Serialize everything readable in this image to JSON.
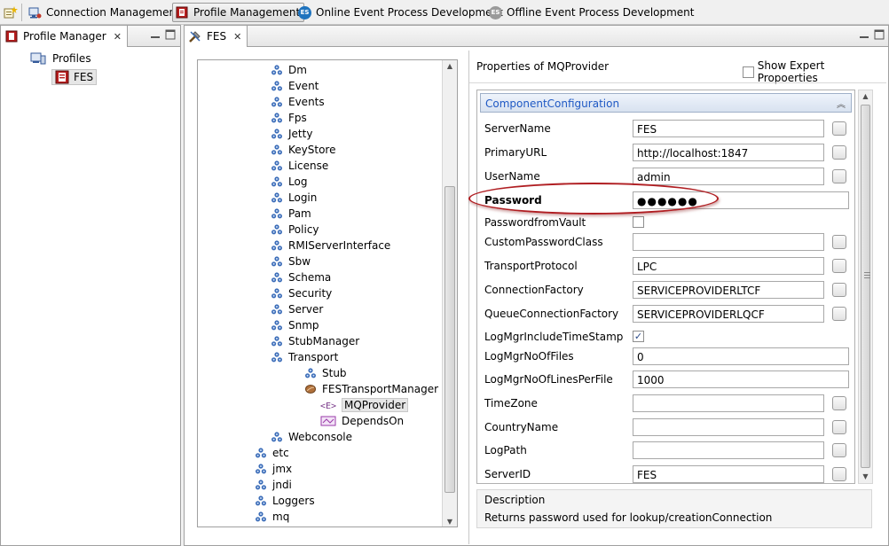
{
  "perspectives": [
    {
      "label": "Connection Management",
      "icon": "connection-icon"
    },
    {
      "label": "Profile Management",
      "icon": "profile-icon",
      "active": true
    },
    {
      "label": "Online Event Process Development",
      "icon": "es-online-icon"
    },
    {
      "label": "Offline Event Process Development",
      "icon": "es-offline-icon"
    }
  ],
  "profile_manager": {
    "tab_label": "Profile Manager",
    "root_label": "Profiles",
    "child_label": "FES"
  },
  "editor": {
    "tab_label": "FES",
    "tree": [
      {
        "label": "Dm",
        "icon": "package-icon"
      },
      {
        "label": "Event",
        "icon": "package-icon"
      },
      {
        "label": "Events",
        "icon": "package-icon"
      },
      {
        "label": "Fps",
        "icon": "package-icon"
      },
      {
        "label": "Jetty",
        "icon": "package-icon"
      },
      {
        "label": "KeyStore",
        "icon": "package-icon"
      },
      {
        "label": "License",
        "icon": "package-icon"
      },
      {
        "label": "Log",
        "icon": "package-icon"
      },
      {
        "label": "Login",
        "icon": "package-icon"
      },
      {
        "label": "Pam",
        "icon": "package-icon"
      },
      {
        "label": "Policy",
        "icon": "package-icon"
      },
      {
        "label": "RMIServerInterface",
        "icon": "package-icon"
      },
      {
        "label": "Sbw",
        "icon": "package-icon"
      },
      {
        "label": "Schema",
        "icon": "package-icon"
      },
      {
        "label": "Security",
        "icon": "package-icon"
      },
      {
        "label": "Server",
        "icon": "package-icon"
      },
      {
        "label": "Snmp",
        "icon": "package-icon"
      },
      {
        "label": "StubManager",
        "icon": "package-icon"
      },
      {
        "label": "Transport",
        "icon": "package-icon"
      },
      {
        "label": "Stub",
        "icon": "package-icon"
      },
      {
        "label": "FESTransportManager",
        "icon": "bean-icon"
      },
      {
        "label": "MQProvider",
        "icon": "element-icon",
        "selected": true
      },
      {
        "label": "DependsOn",
        "icon": "depends-icon"
      },
      {
        "label": "Webconsole",
        "icon": "package-icon"
      },
      {
        "label": "etc",
        "icon": "package-icon"
      },
      {
        "label": "jmx",
        "icon": "package-icon"
      },
      {
        "label": "jndi",
        "icon": "package-icon"
      },
      {
        "label": "Loggers",
        "icon": "package-icon"
      },
      {
        "label": "mq",
        "icon": "package-icon"
      }
    ],
    "properties_title": "Properties of MQProvider",
    "show_expert_label": "Show Expert Propoerties",
    "section_title": "ComponentConfiguration",
    "properties": [
      {
        "label": "ServerName",
        "value": "FES",
        "kind": "text-btn"
      },
      {
        "label": "PrimaryURL",
        "value": "http://localhost:1847",
        "kind": "text-btn"
      },
      {
        "label": "UserName",
        "value": "admin",
        "kind": "text-btn"
      },
      {
        "label": "Password",
        "value": "●●●●●●",
        "kind": "password",
        "bold": true
      },
      {
        "label": "PasswordfromVault",
        "value": "",
        "kind": "checkbox",
        "checked": false
      },
      {
        "label": "CustomPasswordClass",
        "value": "",
        "kind": "text-btn"
      },
      {
        "label": "TransportProtocol",
        "value": "LPC",
        "kind": "text-btn"
      },
      {
        "label": "ConnectionFactory",
        "value": "SERVICEPROVIDERLTCF",
        "kind": "text-btn"
      },
      {
        "label": "QueueConnectionFactory",
        "value": "SERVICEPROVIDERLQCF",
        "kind": "text-btn"
      },
      {
        "label": "LogMgrIncludeTimeStamp",
        "value": "",
        "kind": "checkbox",
        "checked": true
      },
      {
        "label": "LogMgrNoOfFiles",
        "value": "0",
        "kind": "text"
      },
      {
        "label": "LogMgrNoOfLinesPerFile",
        "value": "1000",
        "kind": "text"
      },
      {
        "label": "TimeZone",
        "value": "",
        "kind": "text-btn"
      },
      {
        "label": "CountryName",
        "value": "",
        "kind": "text-btn"
      },
      {
        "label": "LogPath",
        "value": "",
        "kind": "text-btn"
      },
      {
        "label": "ServerID",
        "value": "FES",
        "kind": "text-btn"
      }
    ],
    "description_heading": "Description",
    "description_text": "Returns password used for lookup/creationConnection"
  }
}
